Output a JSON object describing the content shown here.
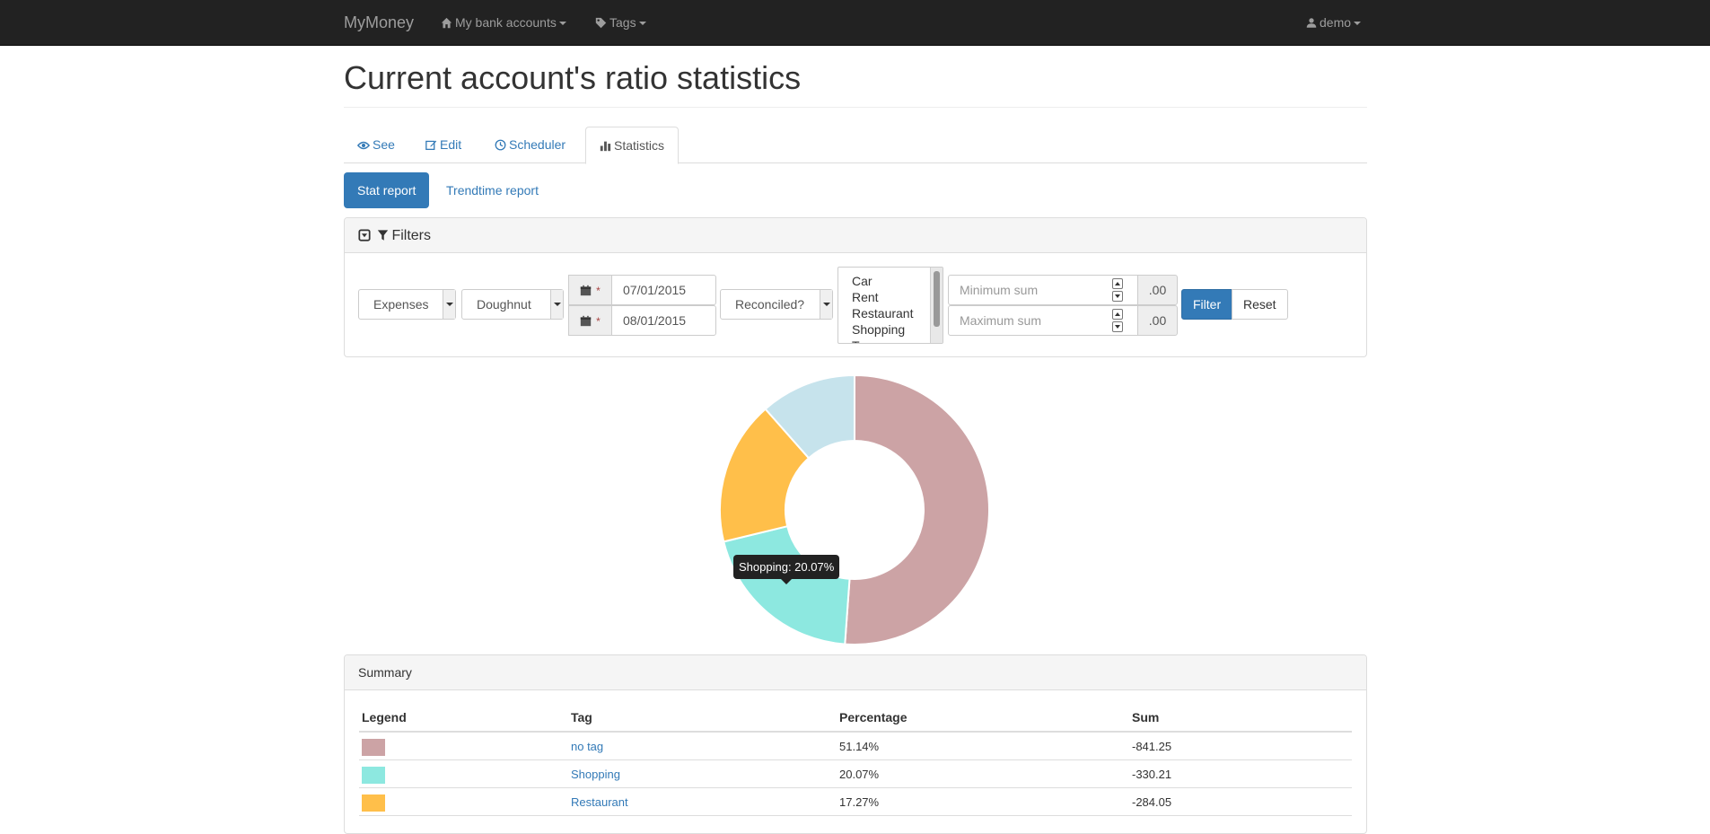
{
  "navbar": {
    "brand": "MyMoney",
    "bank_accounts": "My bank accounts",
    "tags": "Tags",
    "user": "demo"
  },
  "page": {
    "title": "Current account's ratio statistics"
  },
  "tabs": [
    {
      "label": "See",
      "icon": "eye-icon"
    },
    {
      "label": "Edit",
      "icon": "edit-icon"
    },
    {
      "label": "Scheduler",
      "icon": "clock-icon"
    },
    {
      "label": "Statistics",
      "icon": "bar-chart-icon",
      "active": true
    }
  ],
  "reports": {
    "stat": "Stat report",
    "trendtime": "Trendtime report"
  },
  "filters": {
    "heading": "Filters",
    "type_value": "Expenses",
    "chart_value": "Doughnut",
    "date_start": "07/01/2015",
    "date_end": "08/01/2015",
    "reconciled_value": "Reconciled?",
    "tag_options": [
      "Car",
      "Rent",
      "Restaurant",
      "Shopping",
      "T"
    ],
    "min_placeholder": "Minimum sum",
    "max_placeholder": "Maximum sum",
    "decimal_addon": ".00",
    "filter_button": "Filter",
    "reset_button": "Reset"
  },
  "chart_data": {
    "type": "pie",
    "categories": [
      "no tag",
      "Shopping",
      "Restaurant",
      ""
    ],
    "values": [
      51.14,
      20.07,
      17.27,
      11.52
    ],
    "colors": [
      "#cca3a5",
      "#8de8e0",
      "#ffbf4a",
      "#c6e3ec"
    ],
    "tooltip": "Shopping: 20.07%"
  },
  "summary": {
    "heading": "Summary",
    "columns": [
      "Legend",
      "Tag",
      "Percentage",
      "Sum"
    ],
    "rows": [
      {
        "tag": "no tag",
        "percentage": "51.14%",
        "sum": "-841.25",
        "color": "#cca3a5"
      },
      {
        "tag": "Shopping",
        "percentage": "20.07%",
        "sum": "-330.21",
        "color": "#8de8e0"
      },
      {
        "tag": "Restaurant",
        "percentage": "17.27%",
        "sum": "-284.05",
        "color": "#ffbf4a"
      }
    ]
  }
}
